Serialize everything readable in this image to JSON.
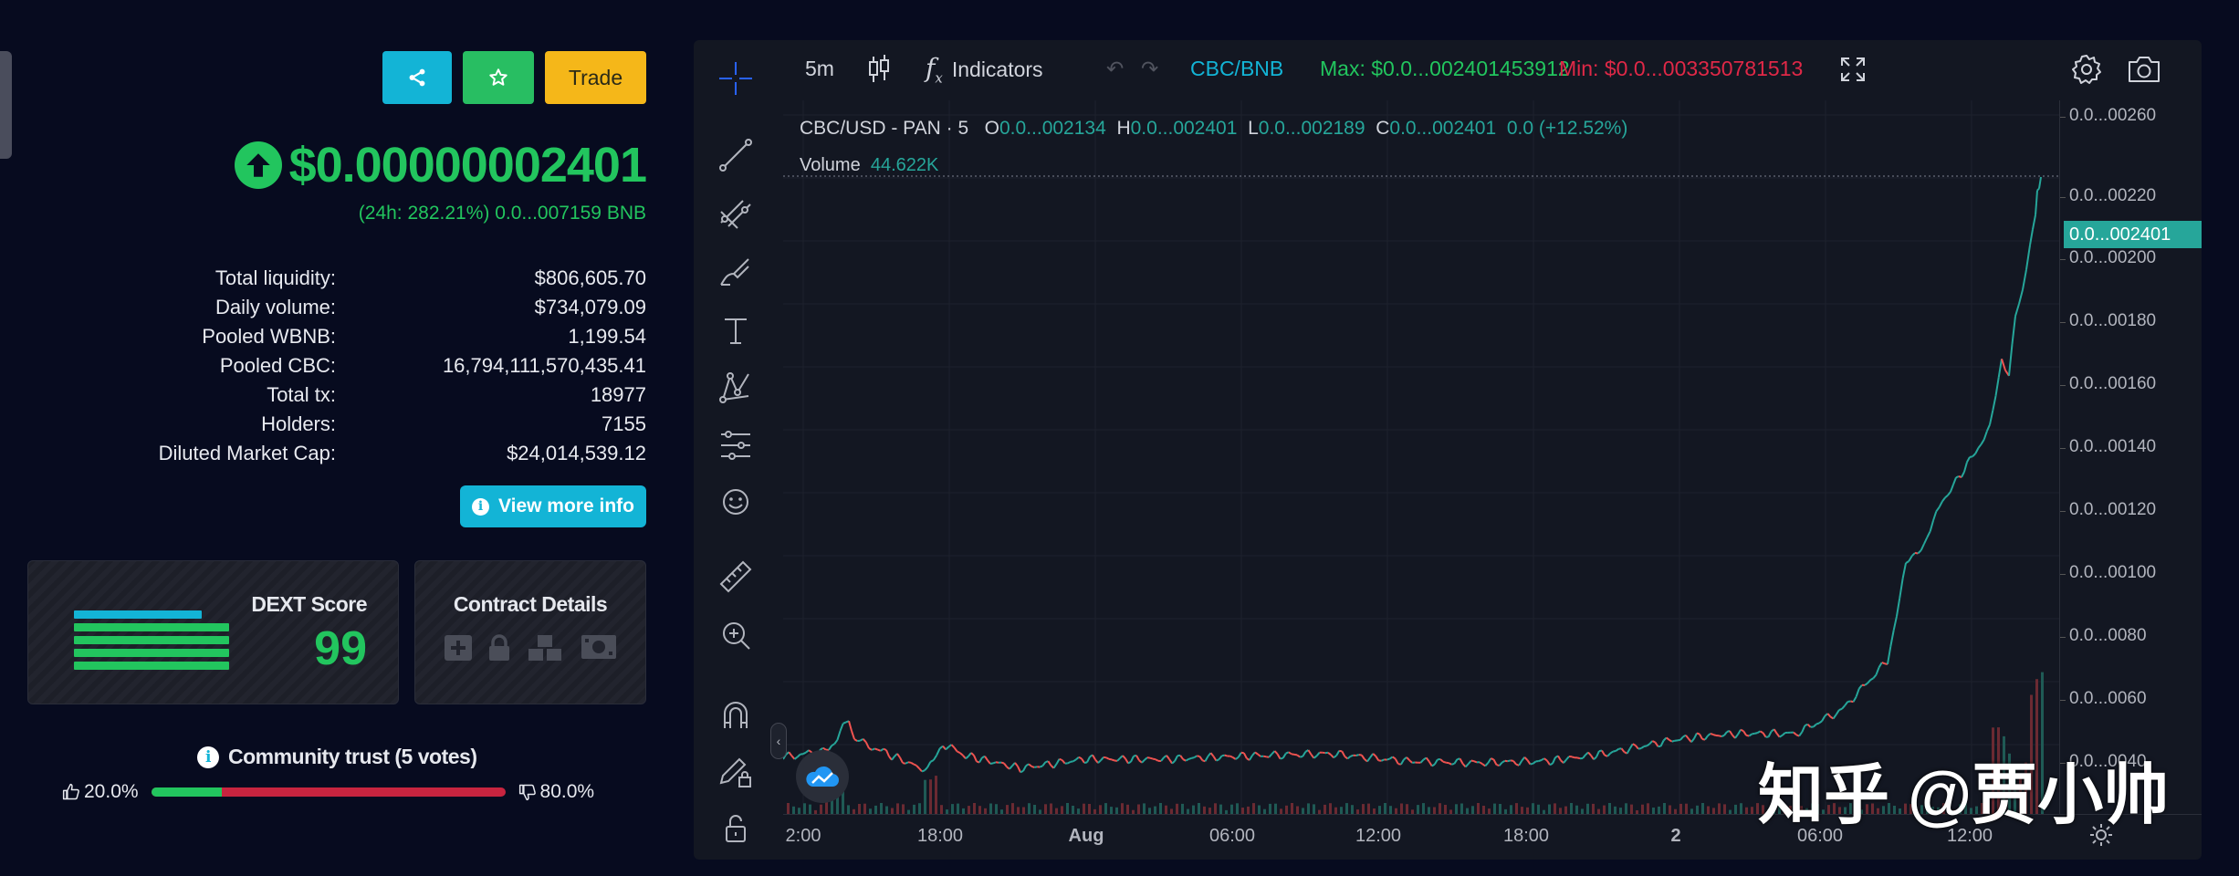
{
  "left_panel": {
    "trade_label": "Trade",
    "price": "$0.00000002401",
    "change_24h": "(24h: 282.21%) 0.0...007159 BNB",
    "stats": [
      {
        "label": "Total liquidity:",
        "value": "$806,605.70"
      },
      {
        "label": "Daily volume:",
        "value": "$734,079.09"
      },
      {
        "label": "Pooled WBNB:",
        "value": "1,199.54"
      },
      {
        "label": "Pooled CBC:",
        "value": "16,794,111,570,435.41"
      },
      {
        "label": "Total tx:",
        "value": "18977"
      },
      {
        "label": "Holders:",
        "value": "7155"
      },
      {
        "label": "Diluted Market Cap:",
        "value": "$24,014,539.12"
      }
    ],
    "view_more_label": "View more info",
    "dext_title": "DEXT Score",
    "dext_score": "99",
    "contract_title": "Contract Details",
    "trust_title": "Community trust (5 votes)",
    "trust_up": "20.0%",
    "trust_down": "80.0%",
    "trust_up_fraction": 0.2,
    "colors": {
      "accent_green": "#22c55e",
      "cyan": "#13b4d6",
      "yellow": "#f5b719",
      "red": "#c8243f"
    }
  },
  "chart": {
    "toolbar": {
      "interval": "5m",
      "indicators_label": "Indicators",
      "pair": "CBC/BNB",
      "max": "Max: $0.0...002401453912",
      "min": "Min: $0.0...003350781513"
    },
    "legend": {
      "symbol": "CBC/USD - PAN · 5",
      "o_label": "O",
      "o": "0.0...002134",
      "h_label": "H",
      "h": "0.0...002401",
      "l_label": "L",
      "l": "0.0...002189",
      "c_label": "C",
      "c": "0.0...002401",
      "chg": "0.0 (+12.52%)",
      "volume_label": "Volume",
      "volume": "44.622K"
    },
    "current_price_label": "0.0...002401",
    "price_ticks": [
      "0.0...00260",
      "0.0...00220",
      "0.0...00200",
      "0.0...00180",
      "0.0...00160",
      "0.0...00140",
      "0.0...00120",
      "0.0...00100",
      "0.0...0080",
      "0.0...0060",
      "0.0...0040"
    ],
    "time_ticks": [
      "2:00",
      "18:00",
      "Aug",
      "06:00",
      "12:00",
      "18:00",
      "2",
      "06:00",
      "12:00"
    ],
    "colors": {
      "up": "#26a69a",
      "down": "#ef5350",
      "bg": "#131722",
      "grid": "#1e222d"
    }
  },
  "watermark": "知乎 @贾小帅"
}
